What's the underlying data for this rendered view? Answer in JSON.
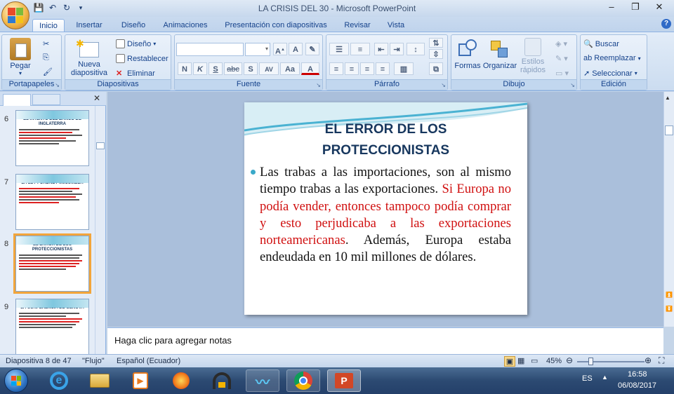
{
  "window": {
    "title": "LA CRISIS DEL 30  -  Microsoft PowerPoint",
    "controls": [
      "–",
      "❐",
      "✕"
    ]
  },
  "tabs": [
    "Inicio",
    "Insertar",
    "Diseño",
    "Animaciones",
    "Presentación con diapositivas",
    "Revisar",
    "Vista"
  ],
  "ribbon": {
    "portapapeles": {
      "label": "Portapapeles",
      "paste": "Pegar"
    },
    "diapositivas": {
      "label": "Diapositivas",
      "new_slide_1": "Nueva",
      "new_slide_2": "diapositiva",
      "layout": "Diseño",
      "reset": "Restablecer",
      "delete": "Eliminar"
    },
    "fuente": {
      "label": "Fuente",
      "bold": "N",
      "italic": "K",
      "underline": "S",
      "strike": "abc",
      "shadow": "S",
      "spacing": "AV",
      "case": "Aa",
      "color": "A"
    },
    "parrafo": {
      "label": "Párrafo"
    },
    "dibujo": {
      "label": "Dibujo",
      "shapes": "Formas",
      "arrange": "Organizar",
      "styles_1": "Estilos",
      "styles_2": "rápidos"
    },
    "edicion": {
      "label": "Edición",
      "find": "Buscar",
      "replace": "Reemplazar",
      "select": "Seleccionar"
    }
  },
  "thumbnails": [
    {
      "num": "6",
      "title": "EL INTENTO DEL BANCO DE INGLATERRA"
    },
    {
      "num": "7",
      "title": "LA LEY FORDNEY-McCUMBER"
    },
    {
      "num": "8",
      "title": "EL ERROR DE LOS PROTECCIONISTAS"
    },
    {
      "num": "9",
      "title": "LA CONFERENCIA DE GÉNOVA"
    }
  ],
  "slide": {
    "title_line1": "EL ERROR DE LOS",
    "title_line2": "PROTECCIONISTAS",
    "body_black1": "Las trabas a las importaciones, son al mismo tiempo trabas a las exportaciones.",
    "body_red": "Si Europa no podía vender, entonces tampoco podía comprar y esto perjudicaba a las exportaciones norteamericanas",
    "body_black2": ". Además, Europa estaba endeudada en 10 mil millones de dólares."
  },
  "notes": {
    "placeholder": "Haga clic para agregar notas"
  },
  "status": {
    "slide": "Diapositiva 8 de 47",
    "theme": "\"Flujo\"",
    "language": "Español (Ecuador)",
    "zoom": "45%"
  },
  "taskbar": {
    "lang": "ES",
    "time": "16:58",
    "date": "06/08/2017"
  }
}
